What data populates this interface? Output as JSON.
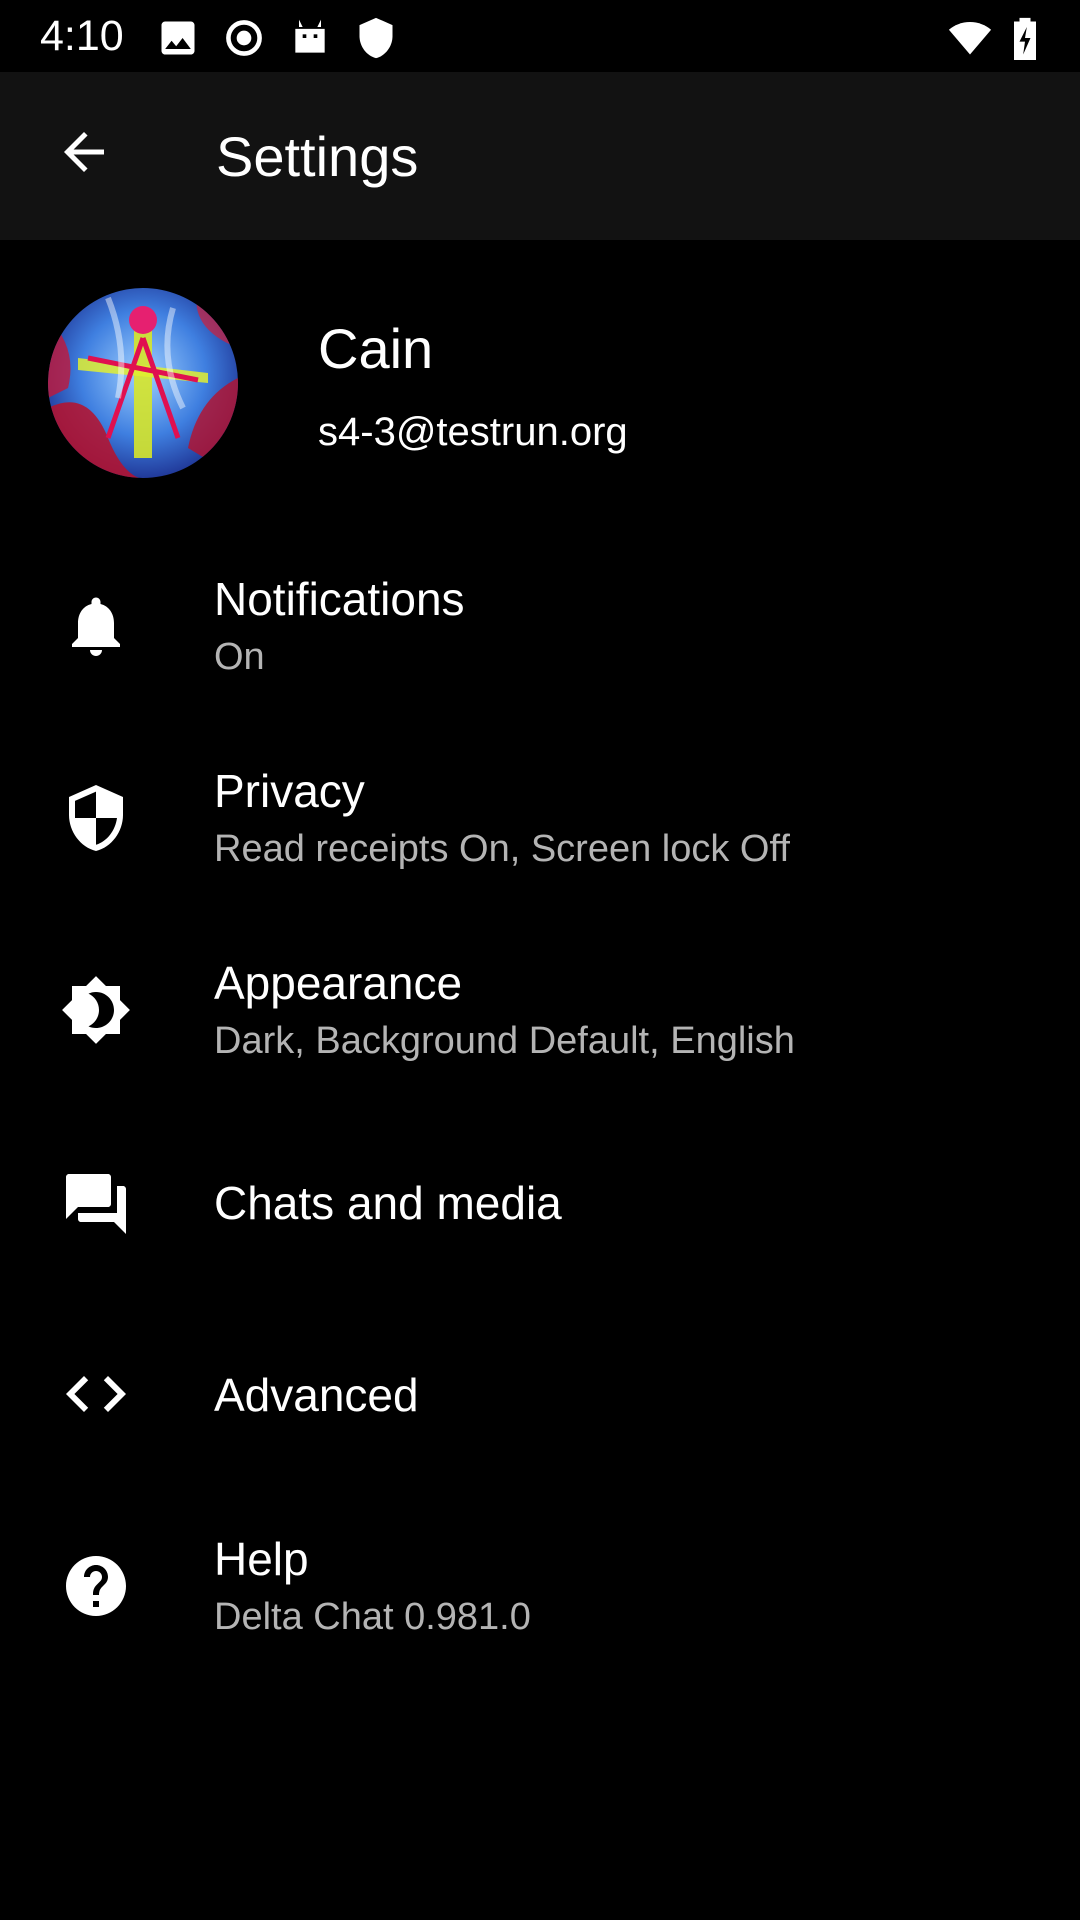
{
  "status_bar": {
    "time": "4:10",
    "left_icons": [
      "image-icon",
      "record-icon",
      "android-icon",
      "shield-icon"
    ],
    "right_icons": [
      "wifi-icon",
      "battery-charging-icon"
    ]
  },
  "app_bar": {
    "back_icon": "arrow-back-icon",
    "title": "Settings"
  },
  "profile": {
    "name": "Cain",
    "email": "s4-3@testrun.org"
  },
  "settings": [
    {
      "icon": "bell-icon",
      "title": "Notifications",
      "summary": "On"
    },
    {
      "icon": "shield-icon",
      "title": "Privacy",
      "summary": "Read receipts On, Screen lock Off"
    },
    {
      "icon": "brightness-icon",
      "title": "Appearance",
      "summary": "Dark, Background Default, English"
    },
    {
      "icon": "chat-icon",
      "title": "Chats and media",
      "summary": ""
    },
    {
      "icon": "code-icon",
      "title": "Advanced",
      "summary": ""
    },
    {
      "icon": "help-icon",
      "title": "Help",
      "summary": "Delta Chat 0.981.0"
    }
  ],
  "colors": {
    "background": "#000000",
    "app_bar": "#121212",
    "primary_text": "#ffffff",
    "secondary_text": "#b4b4b4"
  }
}
